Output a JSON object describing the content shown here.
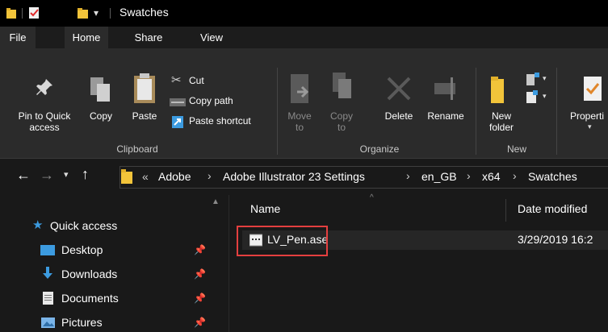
{
  "window": {
    "title": "Swatches"
  },
  "tabs": [
    "File",
    "Home",
    "Share",
    "View"
  ],
  "ribbon": {
    "clipboard": {
      "pin_label_1": "Pin to Quick",
      "pin_label_2": "access",
      "copy": "Copy",
      "paste": "Paste",
      "cut": "Cut",
      "copy_path": "Copy path",
      "paste_shortcut": "Paste shortcut",
      "group": "Clipboard"
    },
    "organize": {
      "move_to_1": "Move",
      "move_to_2": "to",
      "copy_to_1": "Copy",
      "copy_to_2": "to",
      "delete": "Delete",
      "rename": "Rename",
      "group": "Organize"
    },
    "new": {
      "new_folder_1": "New",
      "new_folder_2": "folder",
      "group": "New"
    },
    "open": {
      "properties": "Properti"
    }
  },
  "address": {
    "overflow": "«",
    "crumbs": [
      "Adobe",
      "Adobe Illustrator 23 Settings",
      "en_GB",
      "x64",
      "Swatches"
    ]
  },
  "nav": {
    "items": [
      {
        "label": "Quick access",
        "icon": "star-icon"
      },
      {
        "label": "Desktop",
        "icon": "desktop-folder-icon"
      },
      {
        "label": "Downloads",
        "icon": "downloads-icon"
      },
      {
        "label": "Documents",
        "icon": "documents-icon"
      },
      {
        "label": "Pictures",
        "icon": "pictures-icon"
      }
    ]
  },
  "columns": {
    "name": "Name",
    "date_modified": "Date modified"
  },
  "files": [
    {
      "name": "LV_Pen.ase",
      "date": "3/29/2019 16:2",
      "icon": "ase-file-icon"
    }
  ],
  "colors": {
    "highlight_box": "#e43f3f",
    "accent_blue": "#3c9be0",
    "folder_yellow": "#f2c43a"
  }
}
